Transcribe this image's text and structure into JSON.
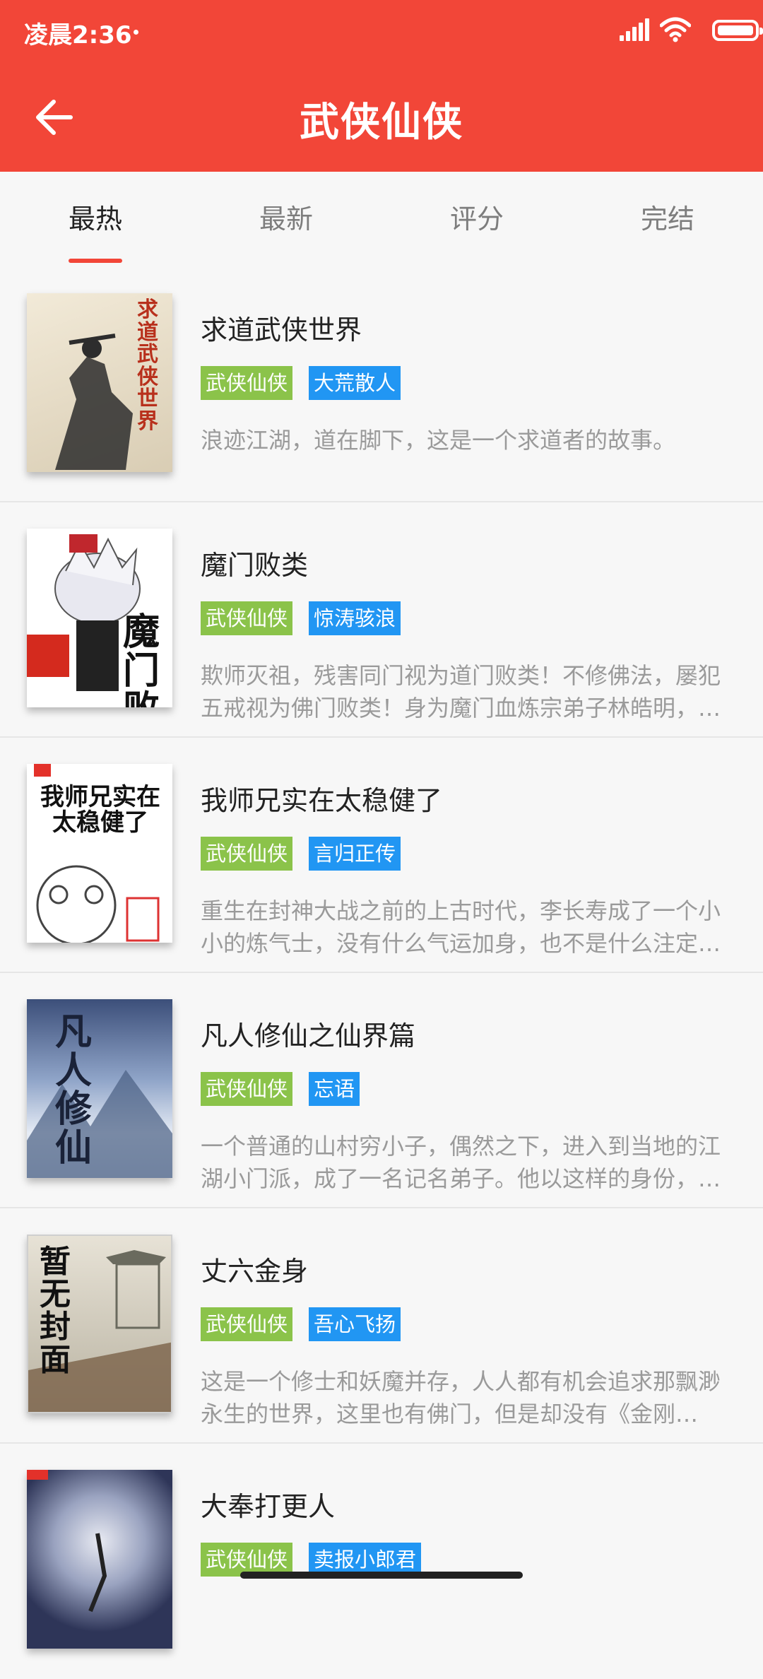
{
  "status": {
    "time": "凌晨2:36"
  },
  "header": {
    "title": "武侠仙侠"
  },
  "tabs": [
    {
      "label": "最热",
      "active": true
    },
    {
      "label": "最新",
      "active": false
    },
    {
      "label": "评分",
      "active": false
    },
    {
      "label": "完结",
      "active": false
    }
  ],
  "books": [
    {
      "title": "求道武侠世界",
      "category": "武侠仙侠",
      "author": "大荒散人",
      "desc": "浪迹江湖，道在脚下，这是一个求道者的故事。",
      "cover_text": "求道武侠世界"
    },
    {
      "title": "魔门败类",
      "category": "武侠仙侠",
      "author": "惊涛骇浪",
      "desc": "欺师灭祖，残害同门视为道门败类！不修佛法，屡犯五戒视为佛门败类！身为魔门血炼宗弟子林皓明，…",
      "cover_text": "魔门败类"
    },
    {
      "title": "我师兄实在太稳健了",
      "category": "武侠仙侠",
      "author": "言归正传",
      "desc": "重生在封神大战之前的上古时代，李长寿成了一个小小的炼气士，没有什么气运加身，也不是什么注定…",
      "cover_text": "我师兄实在太稳健了"
    },
    {
      "title": "凡人修仙之仙界篇",
      "category": "武侠仙侠",
      "author": "忘语",
      "desc": "一个普通的山村穷小子，偶然之下，进入到当地的江湖小门派，成了一名记名弟子。他以这样的身份，…",
      "cover_text": "凡人修仙"
    },
    {
      "title": "丈六金身",
      "category": "武侠仙侠",
      "author": "吾心飞扬",
      "desc": "这是一个修士和妖魔并存，人人都有机会追求那飘渺永生的世界，这里也有佛门，但是却没有《金刚…",
      "cover_text": "暂无封面"
    },
    {
      "title": "大奉打更人",
      "category": "武侠仙侠",
      "author": "卖报小郎君",
      "desc": "",
      "cover_text": ""
    }
  ],
  "colors": {
    "primary": "#f24638",
    "tag_category": "#8bc34a",
    "tag_author": "#2196f3"
  }
}
